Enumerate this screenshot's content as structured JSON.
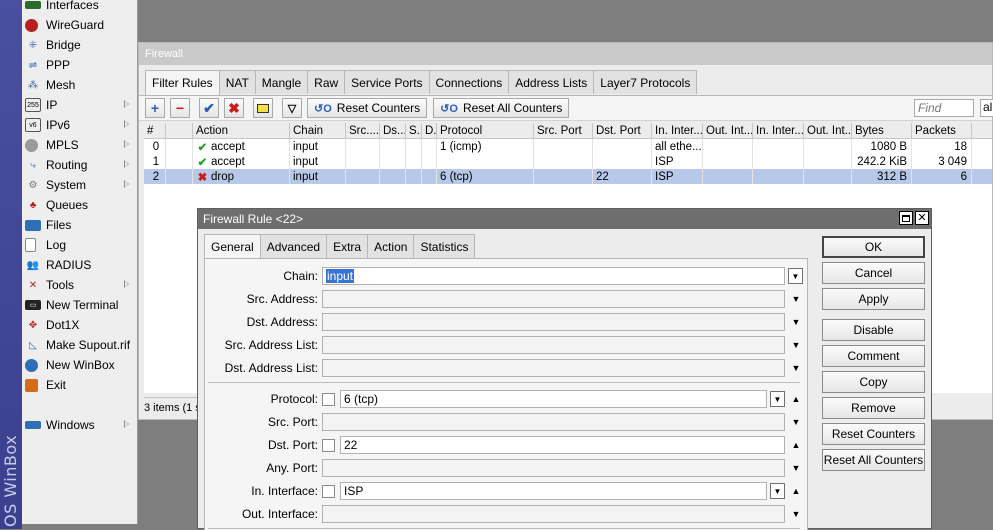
{
  "brand": {
    "text": "OS WinBox"
  },
  "sidebar": {
    "items": [
      {
        "label": "Interfaces"
      },
      {
        "label": "WireGuard"
      },
      {
        "label": "Bridge"
      },
      {
        "label": "PPP"
      },
      {
        "label": "Mesh"
      },
      {
        "label": "IP"
      },
      {
        "label": "IPv6"
      },
      {
        "label": "MPLS"
      },
      {
        "label": "Routing"
      },
      {
        "label": "System"
      },
      {
        "label": "Queues"
      },
      {
        "label": "Files"
      },
      {
        "label": "Log"
      },
      {
        "label": "RADIUS"
      },
      {
        "label": "Tools"
      },
      {
        "label": "New Terminal"
      },
      {
        "label": "Dot1X"
      },
      {
        "label": "Make Supout.rif"
      },
      {
        "label": "New WinBox"
      },
      {
        "label": "Exit"
      },
      {
        "label": "Windows"
      }
    ]
  },
  "firewall": {
    "title": "Firewall",
    "tabs": [
      {
        "label": "Filter Rules"
      },
      {
        "label": "NAT"
      },
      {
        "label": "Mangle"
      },
      {
        "label": "Raw"
      },
      {
        "label": "Service Ports"
      },
      {
        "label": "Connections"
      },
      {
        "label": "Address Lists"
      },
      {
        "label": "Layer7 Protocols"
      }
    ],
    "toolbar": {
      "reset_counters": "Reset Counters",
      "reset_all_counters": "Reset All Counters",
      "find_placeholder": "Find",
      "find_scope": "all"
    },
    "table": {
      "columns": [
        "#",
        "Action",
        "Chain",
        "Src....",
        "Ds...",
        "S..",
        "D..",
        "Protocol",
        "Src. Port",
        "Dst. Port",
        "In. Inter...",
        "Out. Int...",
        "In. Inter...",
        "Out. Int...",
        "Bytes",
        "Packets"
      ],
      "rows": [
        {
          "num": "0",
          "action": "accept",
          "chain": "input",
          "protocol": "1 (icmp)",
          "dst_port": "",
          "in_interface": "all ethe...",
          "bytes": "1080 B",
          "packets": "18"
        },
        {
          "num": "1",
          "action": "accept",
          "chain": "input",
          "protocol": "",
          "dst_port": "",
          "in_interface": "ISP",
          "bytes": "242.2 KiB",
          "packets": "3 049"
        },
        {
          "num": "2",
          "action": "drop",
          "chain": "input",
          "protocol": "6 (tcp)",
          "dst_port": "22",
          "in_interface": "ISP",
          "bytes": "312 B",
          "packets": "6"
        }
      ]
    },
    "status": "3 items (1 s"
  },
  "rule_dialog": {
    "title": "Firewall Rule <22>",
    "tabs": [
      {
        "label": "General"
      },
      {
        "label": "Advanced"
      },
      {
        "label": "Extra"
      },
      {
        "label": "Action"
      },
      {
        "label": "Statistics"
      }
    ],
    "fields": {
      "chain_label": "Chain:",
      "chain_value": "input",
      "src_address_label": "Src. Address:",
      "dst_address_label": "Dst. Address:",
      "src_address_list_label": "Src. Address List:",
      "dst_address_list_label": "Dst. Address List:",
      "protocol_label": "Protocol:",
      "protocol_value": "6 (tcp)",
      "src_port_label": "Src. Port:",
      "dst_port_label": "Dst. Port:",
      "dst_port_value": "22",
      "any_port_label": "Any. Port:",
      "in_interface_label": "In. Interface:",
      "in_interface_value": "ISP",
      "out_interface_label": "Out. Interface:"
    },
    "buttons": {
      "ok": "OK",
      "cancel": "Cancel",
      "apply": "Apply",
      "disable": "Disable",
      "comment": "Comment",
      "copy": "Copy",
      "remove": "Remove",
      "reset_counters": "Reset Counters",
      "reset_all_counters": "Reset All Counters"
    }
  }
}
